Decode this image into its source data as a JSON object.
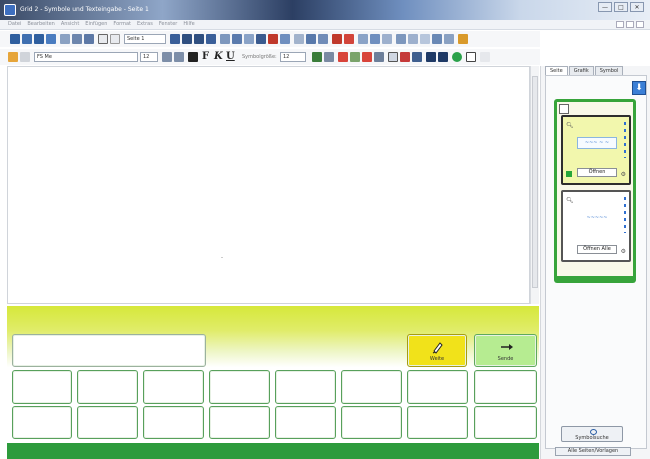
{
  "window": {
    "title": "Grid 2 - Symbole und Texteingabe - Seite 1",
    "controls": [
      "—",
      "□",
      "✕"
    ]
  },
  "menubar": {
    "items": [
      "Datei",
      "Bearbeiten",
      "Ansicht",
      "Einfügen",
      "Format",
      "Extras",
      "Fenster",
      "Hilfe"
    ]
  },
  "toolbar2": {
    "font_name": "FS Me",
    "font_size": "12",
    "symbolsize_label": "Symbolgröße:",
    "symbolsize_value": "12",
    "page_label": "Seite 1"
  },
  "keyboard": {
    "weite_label": "Weite",
    "sende_label": "Sende"
  },
  "right_panel": {
    "tabs": [
      "Seite",
      "Grafik",
      "Symbol"
    ],
    "card1_button": "Öffnen",
    "card2_button": "Öffnen Alle",
    "card1_preview": "~~~ ~ ~",
    "card2_preview": "~~~~~",
    "big_button_label": "Symbolsuche",
    "bottom_button_label": "Alle Seiten/Vorlagen"
  },
  "colors": {
    "keyboard_green": "#2d9b3c",
    "keyboard_yellow": "#d6e83a",
    "weite_key": "#f1e21a",
    "sende_key": "#b6ec91"
  }
}
